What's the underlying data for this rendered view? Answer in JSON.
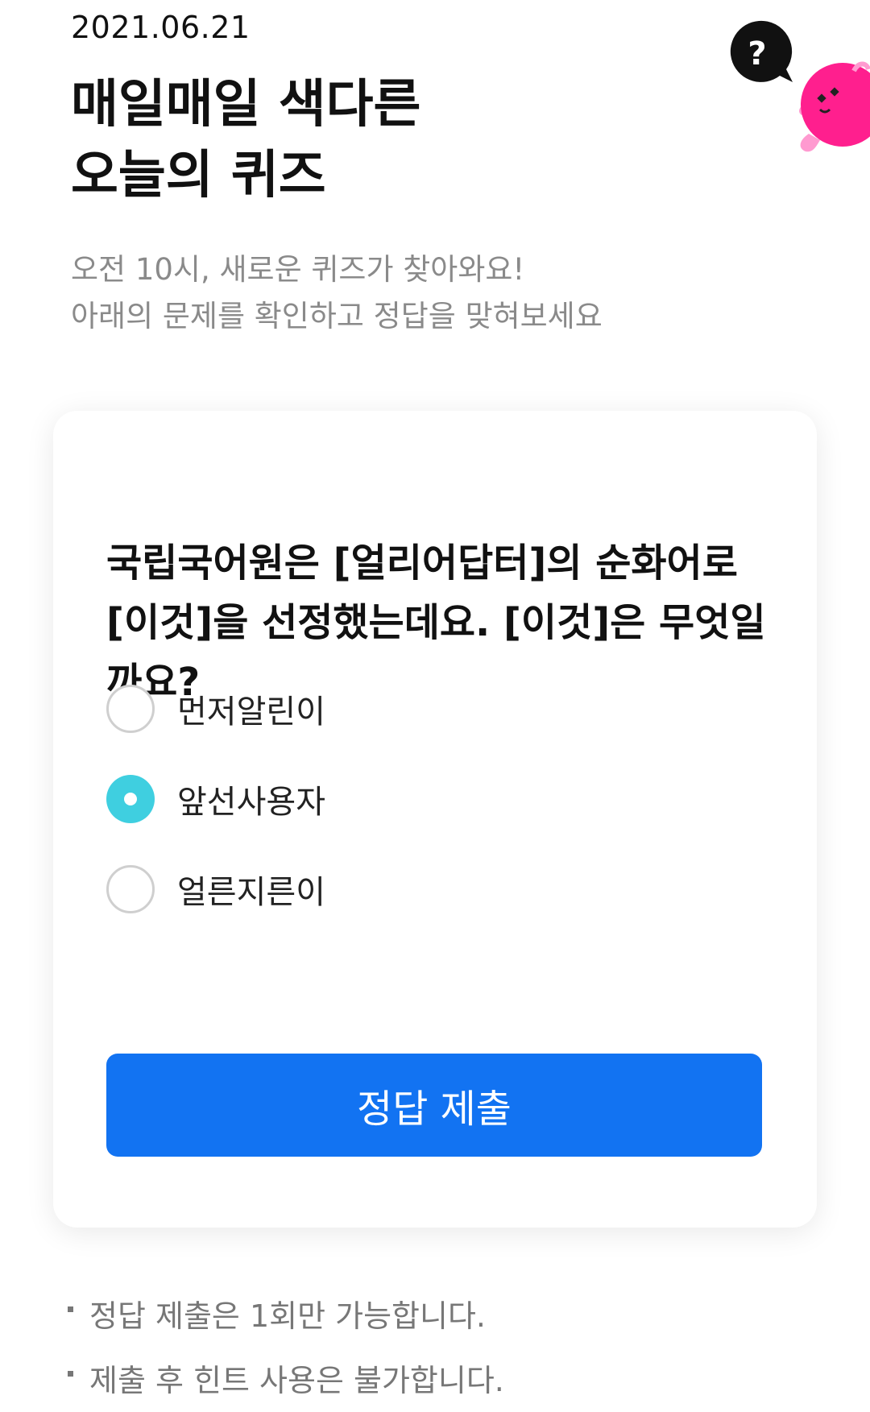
{
  "header": {
    "date": "2021.06.21",
    "title_lines": [
      "매일매일 색다른",
      "오늘의 퀴즈"
    ],
    "subtitle_lines": [
      "오전 10시, 새로운 퀴즈가 찾아와요!",
      "아래의 문제를 확인하고 정답을 맞혀보세요"
    ],
    "help_icon": "question-bubble-icon",
    "mascot": "pink-character-mascot"
  },
  "quiz": {
    "question": "국립국어원은 [얼리어답터]의 순화어로 [이것]을 선정했는데요. [이것]은 무엇일까요?",
    "options": [
      {
        "label": "먼저알린이",
        "selected": false
      },
      {
        "label": "앞선사용자",
        "selected": true
      },
      {
        "label": "얼른지른이",
        "selected": false
      }
    ],
    "submit_label": "정답 제출"
  },
  "notes": [
    "정답 제출은 1회만 가능합니다.",
    "제출 후 힌트 사용은 불가합니다."
  ],
  "colors": {
    "accent_blue": "#1273f2",
    "radio_selected": "#3fcfe0",
    "mascot_pink": "#ff1f8e",
    "subtitle_gray": "#8a8a8a"
  }
}
